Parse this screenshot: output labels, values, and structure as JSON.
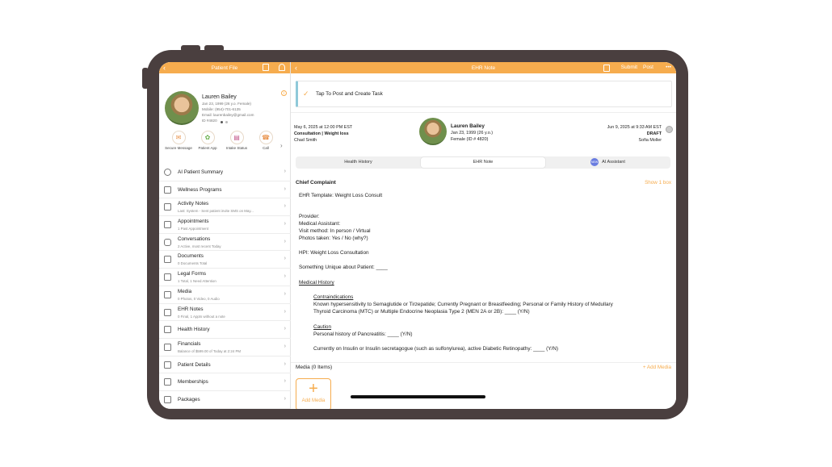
{
  "left_panel": {
    "title": "Patient File",
    "patient": {
      "name": "Lauren Bailey",
      "dob": "Jan 23, 1999 (26 y.o. Female)",
      "mobile": "Mobile: (954)-701-6135",
      "email": "Email: laurenbailey@gmail.com",
      "id": "ID #4820"
    },
    "quick_actions": [
      {
        "label": "Secure Message",
        "icon": "chat-icon"
      },
      {
        "label": "Patient App",
        "icon": "app-icon"
      },
      {
        "label": "Intake Status",
        "icon": "clipboard-icon"
      },
      {
        "label": "Call",
        "icon": "phone-icon"
      }
    ],
    "menu": [
      {
        "title": "AI Patient Summary",
        "sub": ""
      },
      {
        "title": "Wellness Programs",
        "sub": ""
      },
      {
        "title": "Activity Notes",
        "sub": "Last: System - Sent patient invite SMS on May..."
      },
      {
        "title": "Appointments",
        "sub": "1 Past Appointment"
      },
      {
        "title": "Conversations",
        "sub": "2 Active, most recent Today"
      },
      {
        "title": "Documents",
        "sub": "0 Documents Total"
      },
      {
        "title": "Legal Forms",
        "sub": "1 Total, 1 Need Attention"
      },
      {
        "title": "Media",
        "sub": "0 Photos, 0 Video, 0 Audio"
      },
      {
        "title": "EHR Notes",
        "sub": "0 Final, 1 Appts without a note"
      },
      {
        "title": "Health History",
        "sub": ""
      },
      {
        "title": "Financials",
        "sub": "Balance of $599.00 of Today at 2:24 PM"
      },
      {
        "title": "Patient Details",
        "sub": ""
      },
      {
        "title": "Memberships",
        "sub": ""
      },
      {
        "title": "Packages",
        "sub": ""
      }
    ]
  },
  "right_panel": {
    "title": "EHR Note",
    "submit": "Submit",
    "post": "Post",
    "more": "•••",
    "task_banner": "Tap To Post and Create Task",
    "encounter": {
      "left_date": "May 6, 2025 at 12:00 PM EST",
      "left_type": "Consultation | Weight loss",
      "left_provider": "Chad Smith",
      "patient_name": "Lauren Bailey",
      "patient_dob": "Jan 23, 1999 (26 y.o.)",
      "patient_sex": "Female (ID # 4820)",
      "right_date": "Jun 9, 2025 at 9:33 AM EST",
      "right_status": "DRAFT",
      "right_author": "Sofia Moller"
    },
    "tabs": [
      "Health History",
      "EHR Note",
      "AI Assistant"
    ],
    "new_badge": "NEW",
    "section_title": "Chief Complaint",
    "show_box": "Show 1 box",
    "note_lines": {
      "template": "EHR Template: Weight Loss Consult",
      "provider": "Provider:",
      "ma": "Medical Assistant:",
      "visit": " Visit method: In person / Virtual",
      "photos": "Photos taken: Yes / No (why?)",
      "hpi": "HPI: Weight Loss Consultation",
      "unique": "Something Unique about Patient: ____",
      "med_history": "Medical History",
      "contra": "Contraindications",
      "contra_1": "Known hypersensitivity to Semaglutide or Tirzepatide; Currently Pregnant or Breastfeeding; Personal or Family History of Medullary",
      "contra_2": "Thyroid Carcinoma (MTC) or Multiple Endocrine Neoplasia Type 2 (MEN 2A or 2B): ____ (Y/N)",
      "caution": "Caution",
      "caution_1": "Personal history of Pancreatitis: ____ (Y/N)",
      "caution_2": "Currently on Insulin or Insulin secretagogue (such as sulfonylurea), active Diabetic Retinopathy: ____ (Y/N)"
    },
    "media_title": "Media (0 Items)",
    "add_media_link": "+ Add Media",
    "add_media_button": "Add Media"
  }
}
